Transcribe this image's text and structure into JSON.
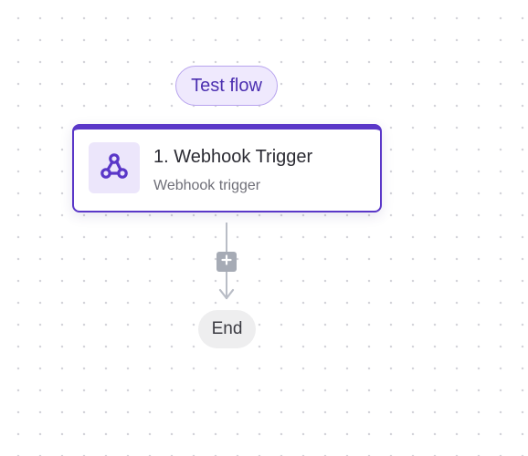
{
  "toolbar": {
    "test_flow_label": "Test flow"
  },
  "steps": [
    {
      "title": "1. Webhook Trigger",
      "subtitle": "Webhook trigger",
      "icon": "webhook-icon"
    }
  ],
  "connector": {
    "add_icon": "plus-icon"
  },
  "end_node": {
    "label": "End"
  },
  "colors": {
    "accent": "#5a37c8",
    "accent_light": "#efe9fd",
    "connector": "#b9bdc6",
    "end_bg": "#eeeeef"
  }
}
